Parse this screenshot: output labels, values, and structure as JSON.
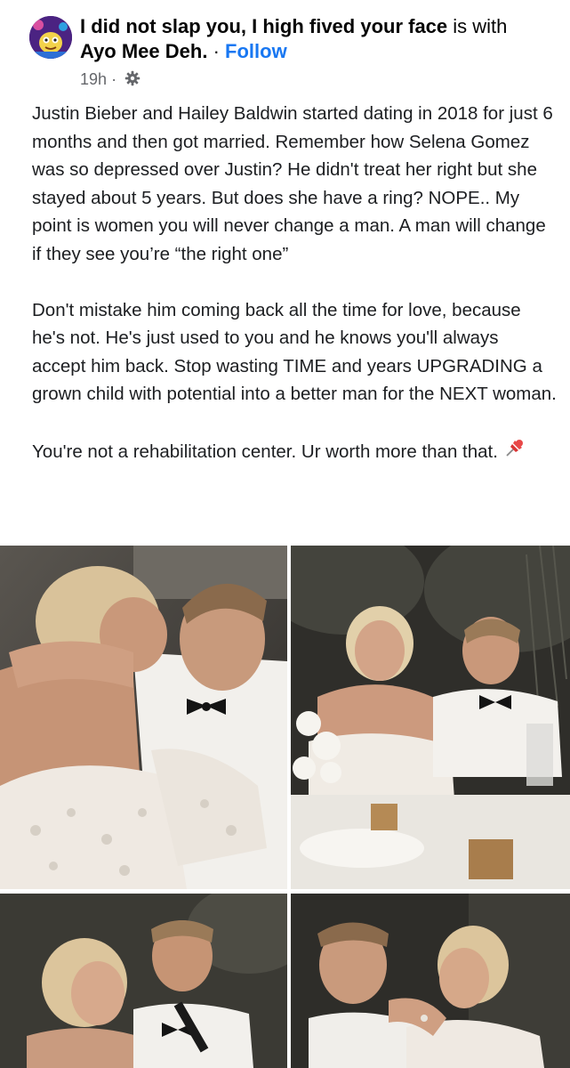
{
  "header": {
    "author_name": "I did not slap you, I high fived your face",
    "with_text": "is with",
    "tagged_name": "Ayo Mee Deh.",
    "separator": "·",
    "follow_label": "Follow",
    "timestamp": "19h",
    "meta_separator": "·",
    "audience_icon": "gear-icon",
    "avatar_icon": "cartoon-character-avatar"
  },
  "post": {
    "paragraphs": [
      "Justin Bieber and Hailey Baldwin started dating in 2018 for just 6 months and then got married. Remember how Selena Gomez was so depressed over Justin? He didn't treat her right but she stayed about 5 years. But does she have a ring? NOPE.. My point is women you will never change a man. A man will change if they see you’re “the right one”",
      "Don't mistake him coming back all the time for love, because he's not. He's just used to you and he knows you'll always accept him back. Stop wasting TIME and years UPGRADING a grown child with potential into a better man for the NEXT woman.",
      "You're not a rehabilitation center. Ur worth more than that."
    ],
    "end_icon": "pushpin-icon"
  },
  "photos": {
    "count": 4,
    "colors": {
      "skin": "#c9987a",
      "hair_blonde": "#d9c29a",
      "hair_brown": "#8a6a4c",
      "dress": "#efe9e2",
      "tux_black": "#141414",
      "background_dark": "#3a3a34"
    }
  }
}
